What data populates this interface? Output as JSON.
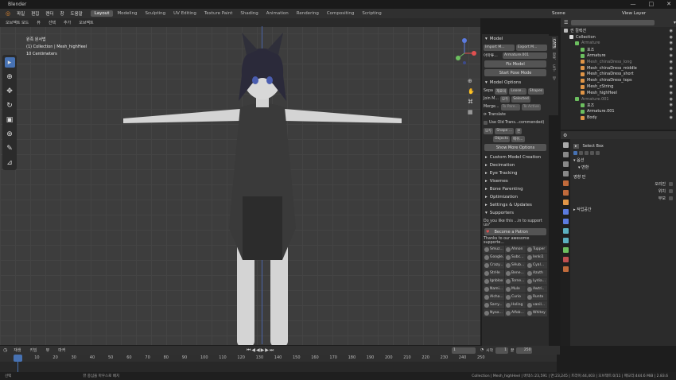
{
  "window": {
    "title": "Blender",
    "controls": [
      "—",
      "□",
      "✕"
    ]
  },
  "menubar": {
    "menus": [
      "파일",
      "편집",
      "렌더",
      "창",
      "도움말"
    ],
    "workspaces": [
      "Layout",
      "Modeling",
      "Sculpting",
      "UV Editing",
      "Texture Paint",
      "Shading",
      "Animation",
      "Rendering",
      "Compositing",
      "Scripting"
    ],
    "scene": "Scene",
    "view_layer": "View Layer"
  },
  "viewport": {
    "header": [
      "오브젝트 모드",
      "뷰",
      "선택",
      "추가",
      "오브젝트"
    ],
    "info": [
      "원족 원서법",
      "(1) Collection | Mesh_highHeel",
      "10 Centimeters"
    ]
  },
  "cats": {
    "tabs": [
      "CATS",
      "항목",
      "도구",
      "뷰"
    ],
    "model_title": "Model",
    "import": "Import M...",
    "export": "Export M...",
    "armature_label": "아마튜...",
    "armature_value": "Armature.001",
    "fix_model": "Fix Model",
    "start_pose": "Start Pose Mode",
    "model_options": "Model Options",
    "opt_rows": [
      [
        "Sepa",
        "재료의",
        "Loose...",
        "Shapes"
      ],
      [
        "Join M...",
        "모두",
        "Selected"
      ],
      [
        "Merge...",
        "To Pare...",
        "To Active"
      ]
    ],
    "translate": "Translate",
    "old_trans": "Use Old Trans...commended)",
    "mini_rows": [
      [
        "모두",
        "Shape ...",
        "본"
      ],
      [
        "Objects",
        "",
        "메쉬..."
      ]
    ],
    "show_more": "Show More Options",
    "sections": [
      "Custom Model Creation",
      "Decimation",
      "Eye Tracking",
      "Visemes",
      "Bone Parenting",
      "Optimization",
      "Settings & Updates",
      "Supporters"
    ],
    "support_q": "Do you like this ...in to support us?",
    "patron": "Become a Patron",
    "thanks": "Thanks to our awesome supporte...",
    "supporters": [
      "Smuz...",
      "Ahnon",
      "Tupper",
      "Google...",
      "Subc...",
      "Ienki1",
      "Crazy...",
      "SHub...",
      "Cyal...",
      "StrHe",
      "Bene...",
      "Azuth",
      "Ignblox",
      "Torne...",
      "Lydia...",
      "Nami...",
      "Mule",
      "Awtri..",
      "Alcha...",
      "Curio",
      "Runta",
      "Sarry...",
      "Holing",
      "vanil...",
      "Nyaa...",
      "Alfob...",
      "Whitey"
    ]
  },
  "outliner": {
    "search": "",
    "rows": [
      {
        "t": "씬 컬렉션",
        "d": 0,
        "c": "#bbbbbb",
        "dim": false
      },
      {
        "t": "Collection",
        "d": 1,
        "c": "#dddddd",
        "dim": false
      },
      {
        "t": "Armature",
        "d": 2,
        "c": "#6cbf5f",
        "dim": true
      },
      {
        "t": "포즈",
        "d": 3,
        "c": "#6cbf5f",
        "dim": false
      },
      {
        "t": "Armature",
        "d": 3,
        "c": "#6cbf5f",
        "dim": false
      },
      {
        "t": "Mesh_chinaDress_long",
        "d": 3,
        "c": "#e09547",
        "dim": true
      },
      {
        "t": "Mesh_chinaDress_middle",
        "d": 3,
        "c": "#e09547",
        "dim": false
      },
      {
        "t": "Mesh_chinaDress_short",
        "d": 3,
        "c": "#e09547",
        "dim": false
      },
      {
        "t": "Mesh_chinaDress_tops",
        "d": 3,
        "c": "#e09547",
        "dim": false
      },
      {
        "t": "Mesh_cString",
        "d": 3,
        "c": "#e09547",
        "dim": false
      },
      {
        "t": "Mesh_highHeel",
        "d": 3,
        "c": "#e09547",
        "dim": false
      },
      {
        "t": "Armature.001",
        "d": 2,
        "c": "#6cbf5f",
        "dim": true
      },
      {
        "t": "포즈",
        "d": 3,
        "c": "#6cbf5f",
        "dim": false
      },
      {
        "t": "Armature.001",
        "d": 3,
        "c": "#6cbf5f",
        "dim": false
      },
      {
        "t": "Body",
        "d": 3,
        "c": "#e09547",
        "dim": false
      }
    ]
  },
  "properties": {
    "tool": "Select Box",
    "sub": "옵션",
    "transform": "변환",
    "affect": "영향 만",
    "opts": [
      "오리진",
      "위치",
      "부모"
    ],
    "workspace": "작업공간"
  },
  "timeline": {
    "menus": [
      "재생",
      "키잉",
      "뷰",
      "마커"
    ],
    "frame": "1",
    "start_label": "시작",
    "start": "1",
    "end_label": "끝",
    "end": "250",
    "ticks": [
      "1",
      "10",
      "20",
      "30",
      "40",
      "50",
      "60",
      "70",
      "80",
      "90",
      "100",
      "110",
      "120",
      "130",
      "140",
      "150",
      "160",
      "170",
      "180",
      "190",
      "200",
      "210",
      "220",
      "230",
      "240",
      "250"
    ]
  },
  "status": {
    "left": "선택",
    "mid": "뷰 중심을 마우스로 배치",
    "right": "Collection | Mesh_highHeel | 버텍스:23,591 | 면:23,245 | 트라이:44,403 | 오브젝트:0/11 | 메모리:444.6 MiB | 2.83.6"
  }
}
